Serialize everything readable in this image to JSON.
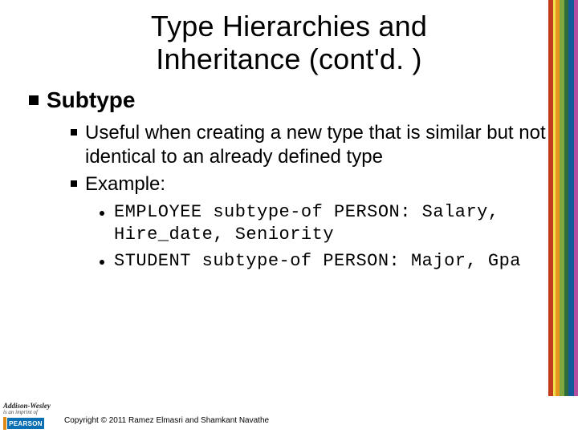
{
  "title_line1": "Type Hierarchies and",
  "title_line2": "Inheritance (cont'd. )",
  "bullet1": "Subtype",
  "sub1": "Useful when creating a new type that is similar but not identical to an already defined type",
  "sub2": "Example:",
  "ex1": "EMPLOYEE subtype-of PERSON: Salary, Hire_date, Seniority",
  "ex2": "STUDENT subtype-of PERSON: Major, Gpa",
  "publisher_line1": "Addison-Wesley",
  "publisher_line2": "is an imprint of",
  "publisher_logo": "PEARSON",
  "copyright": "Copyright © 2011 Ramez Elmasri and Shamkant Navathe"
}
